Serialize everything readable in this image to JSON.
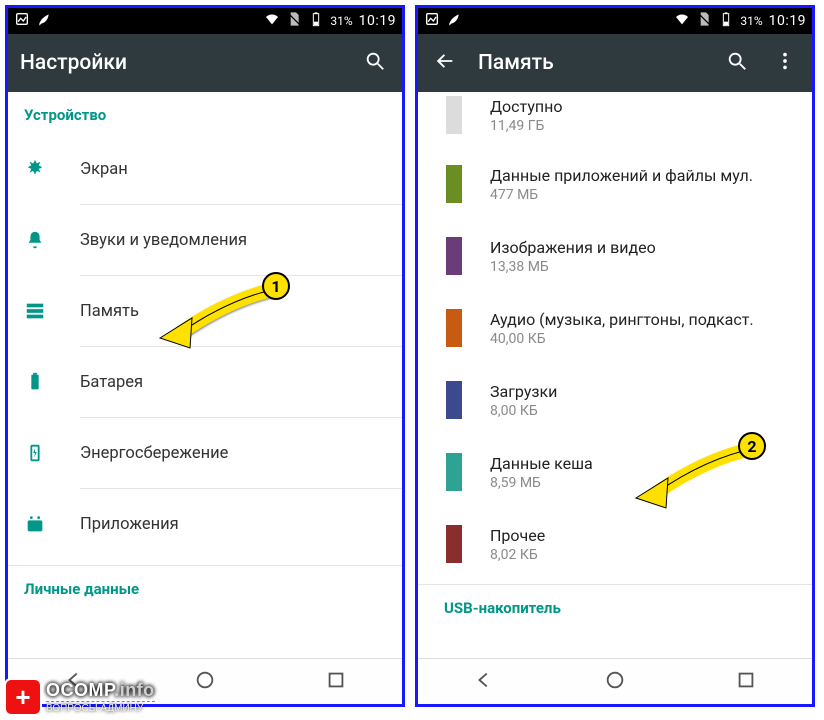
{
  "statusbar": {
    "battery_pct": "31%",
    "time": "10:19"
  },
  "left": {
    "title": "Настройки",
    "section1": "Устройство",
    "items": [
      {
        "label": "Экран"
      },
      {
        "label": "Звуки и уведомления"
      },
      {
        "label": "Память"
      },
      {
        "label": "Батарея"
      },
      {
        "label": "Энергосбережение"
      },
      {
        "label": "Приложения"
      }
    ],
    "section2": "Личные данные"
  },
  "right": {
    "title": "Память",
    "usb_label": "USB-накопитель",
    "items": [
      {
        "title": "Доступно",
        "subtitle": "11,49 ГБ",
        "color": "#dcdcdc"
      },
      {
        "title": "Данные приложений и файлы мул.",
        "subtitle": "477 МБ",
        "color": "#6b8e23"
      },
      {
        "title": "Изображения и видео",
        "subtitle": "13,38 МБ",
        "color": "#6a3d7a"
      },
      {
        "title": "Аудио (музыка, рингтоны, подкаст.",
        "subtitle": "40,00 КБ",
        "color": "#c75b12"
      },
      {
        "title": "Загрузки",
        "subtitle": "8,00 КБ",
        "color": "#3b4a8f"
      },
      {
        "title": "Данные кеша",
        "subtitle": "8,59 МБ",
        "color": "#2fa393"
      },
      {
        "title": "Прочее",
        "subtitle": "8,02 КБ",
        "color": "#8a2d2d"
      }
    ]
  },
  "annotations": {
    "badge1": "1",
    "badge2": "2"
  },
  "watermark": {
    "brand1": "OCOMP",
    "brand2": ".info",
    "tagline": "ВОПРОСЫ АДМИНУ"
  }
}
